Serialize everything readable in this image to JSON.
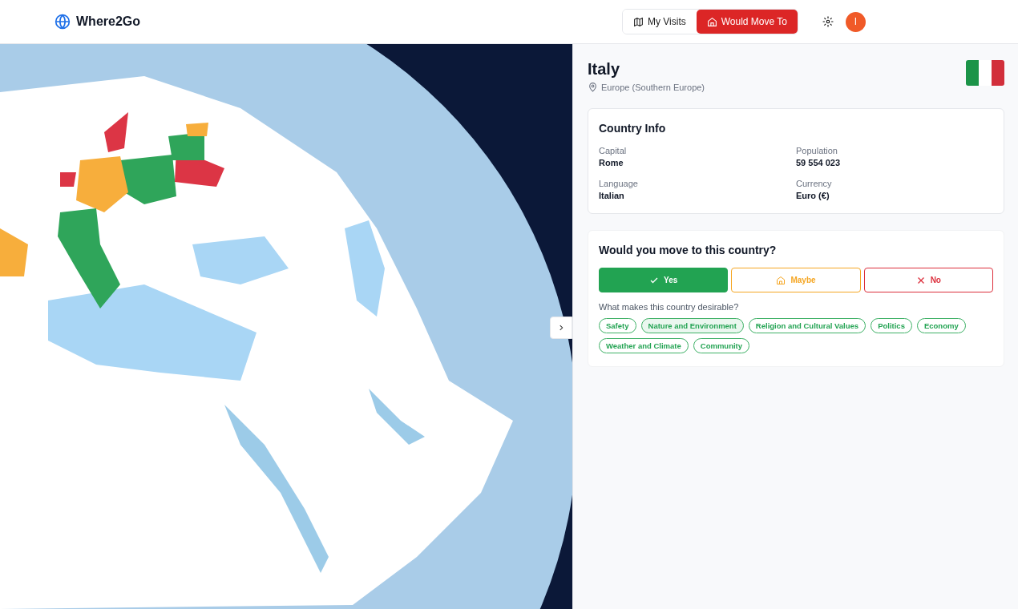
{
  "app": {
    "name": "Where2Go",
    "avatar_letter": "I"
  },
  "nav_tabs": [
    {
      "label": "My Visits",
      "kind": "map",
      "selected": false
    },
    {
      "label": "Would Move To",
      "kind": "home",
      "selected": true
    }
  ],
  "country": {
    "name": "Italy",
    "region": "Europe (Southern Europe)"
  },
  "country_info": {
    "title": "Country Info",
    "fields": [
      {
        "label": "Capital",
        "value": "Rome"
      },
      {
        "label": "Population",
        "value": "59 554 023"
      },
      {
        "label": "Language",
        "value": "Italian"
      },
      {
        "label": "Currency",
        "value": "Euro (€)"
      }
    ]
  },
  "move_question": {
    "title": "Would you move to this country?",
    "options": [
      {
        "label": "Yes",
        "kind": "yes",
        "selected": true
      },
      {
        "label": "Maybe",
        "kind": "maybe",
        "selected": false
      },
      {
        "label": "No",
        "kind": "no",
        "selected": false
      }
    ],
    "prompt": "What makes this country desirable?",
    "tags": [
      {
        "label": "Safety",
        "selected": false
      },
      {
        "label": "Nature and Environment",
        "selected": true
      },
      {
        "label": "Religion and Cultural Values",
        "selected": false
      },
      {
        "label": "Politics",
        "selected": false
      },
      {
        "label": "Economy",
        "selected": false
      },
      {
        "label": "Weather and Climate",
        "selected": false
      },
      {
        "label": "Community",
        "selected": false
      }
    ]
  }
}
